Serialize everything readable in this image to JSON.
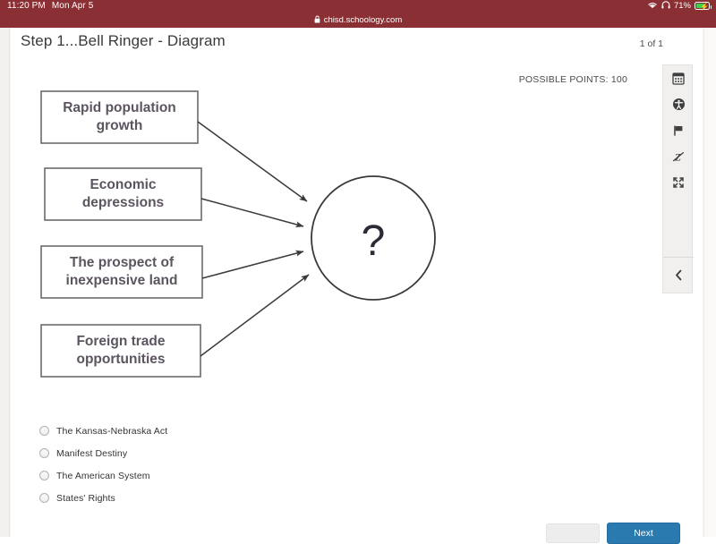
{
  "status_bar": {
    "time": "11:20 PM",
    "date": "Mon Apr 5",
    "wifi_icon": "wifi-icon",
    "headphones_icon": "headphones-icon",
    "battery_percent": "71%",
    "battery_charging": true,
    "bar_color": "#8a2f34"
  },
  "browser": {
    "lock_icon": "lock-icon",
    "url": "chisd.schoology.com"
  },
  "header": {
    "title": "Step 1...Bell Ringer - Diagram",
    "page_counter": "1 of 1",
    "possible_points": "POSSIBLE POINTS: 100"
  },
  "tool_panel": {
    "items": [
      {
        "name": "calculator-icon",
        "label": "Calculator"
      },
      {
        "name": "accessibility-icon",
        "label": "Accessibility"
      },
      {
        "name": "flag-icon",
        "label": "Flag question"
      },
      {
        "name": "strikethrough-icon",
        "label": "Strikethrough answers"
      },
      {
        "name": "fullscreen-icon",
        "label": "Full screen"
      }
    ],
    "collapse_icon": "chevron-left-icon"
  },
  "diagram": {
    "boxes": [
      "Rapid population growth",
      "Economic depressions",
      "The prospect of inexpensive land",
      "Foreign trade opportunities"
    ],
    "center_label": "?",
    "stroke_color": "#6b6b6b",
    "text_color": "#5c5560"
  },
  "answers": {
    "options": [
      {
        "label": "The Kansas-Nebraska Act",
        "selected": false
      },
      {
        "label": "Manifest Destiny",
        "selected": false
      },
      {
        "label": "The American System",
        "selected": false
      },
      {
        "label": "States' Rights",
        "selected": false
      }
    ]
  },
  "footer": {
    "back_label": "",
    "next_label": "Next",
    "next_color": "#2a7ab0"
  }
}
